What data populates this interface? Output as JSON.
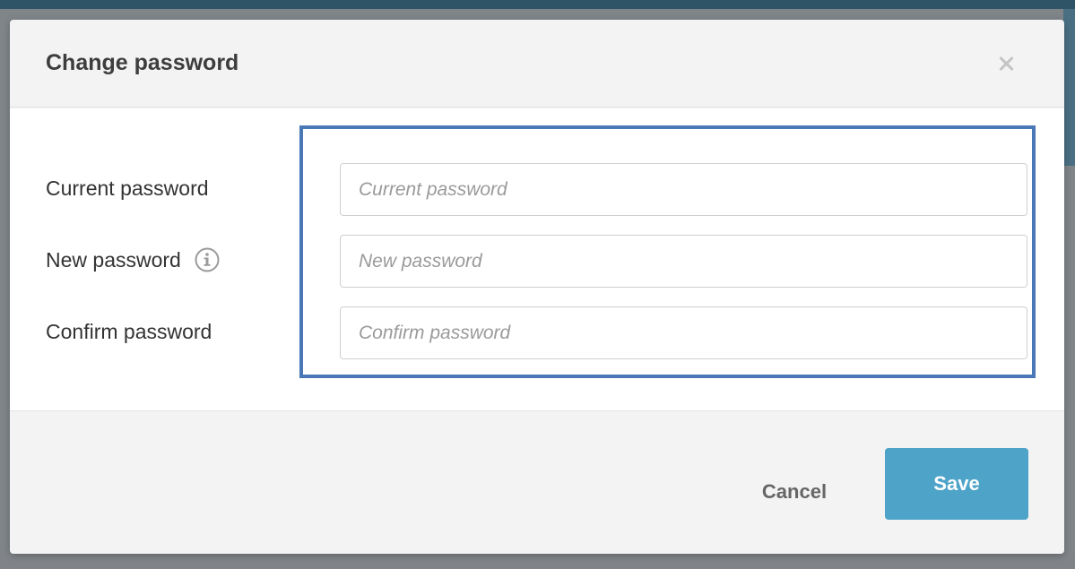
{
  "dialog": {
    "title": "Change password",
    "close_icon": "close-icon"
  },
  "form": {
    "fields": [
      {
        "label": "Current password",
        "placeholder": "Current password",
        "value": ""
      },
      {
        "label": "New password",
        "placeholder": "New password",
        "value": "",
        "icon": "info-icon"
      },
      {
        "label": "Confirm password",
        "placeholder": "Confirm password",
        "value": ""
      }
    ],
    "highlight_color": "#4a77b5"
  },
  "footer": {
    "cancel_label": "Cancel",
    "save_label": "Save",
    "save_color": "#4ea3c9"
  },
  "background": {
    "topbar_color": "#2f5468",
    "overlay_color": "#7f8589"
  }
}
